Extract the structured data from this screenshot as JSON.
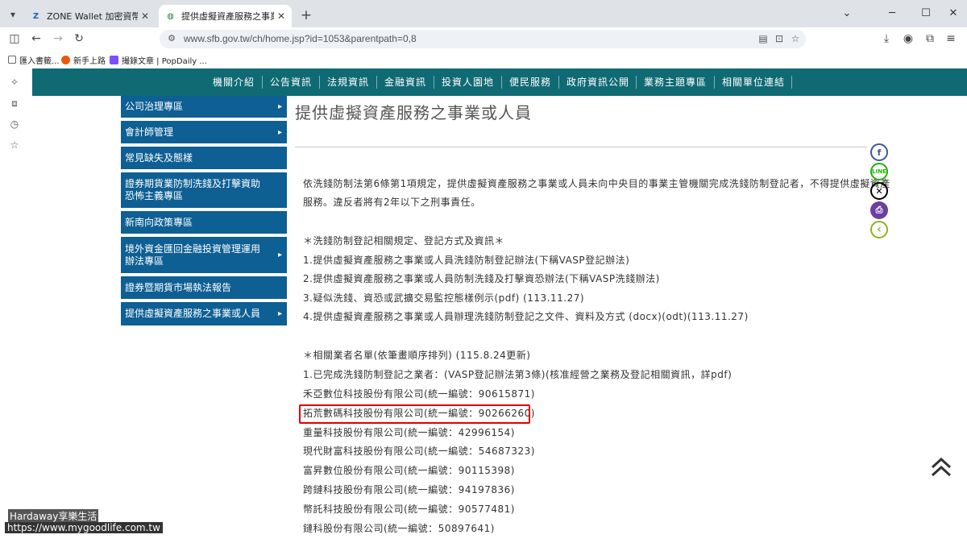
{
  "browser": {
    "tabs": [
      {
        "title": "ZONE Wallet 加密資幣交易所｜",
        "active": false
      },
      {
        "title": "提供虛擬資產服務之事業或人員",
        "active": true
      }
    ],
    "url": "www.sfb.gov.tw/ch/home.jsp?id=1053&parentpath=0,8",
    "bookmarks": [
      "匯入書籤...",
      "新手上路",
      "撮錄文章 | PopDaily ..."
    ]
  },
  "nav": {
    "items": [
      "機關介紹",
      "公告資訊",
      "法規資訊",
      "金融資訊",
      "投資人園地",
      "便民服務",
      "政府資訊公開",
      "業務主題專區",
      "相關單位連結"
    ]
  },
  "sidebar": {
    "items": [
      {
        "label": "公司治理專區",
        "arrow": "▸"
      },
      {
        "label": "會計師管理",
        "arrow": "▸"
      },
      {
        "label": "常見缺失及態樣",
        "arrow": ""
      },
      {
        "label": "證券期貨業防制洗錢及打擊資助恐怖主義專區",
        "arrow": ""
      },
      {
        "label": "新南向政策專區",
        "arrow": ""
      },
      {
        "label": "境外資金匯回金融投資管理運用辦法專區",
        "arrow": "▸"
      },
      {
        "label": "證券暨期貨市場執法報告",
        "arrow": ""
      },
      {
        "label": "提供虛擬資產服務之事業或人員",
        "arrow": "▸"
      }
    ]
  },
  "main": {
    "title": "提供虛擬資產服務之事業或人員",
    "intro_line1": "依洗錢防制法第6條第1項規定，提供虛擬資產服務之事業或人員未向中央目的事業主管機關完成洗錢防制登記者，不得提供虛擬資產",
    "intro_line2": "服務。違反者將有2年以下之刑事責任。",
    "section1_heading": "＊洗錢防制登記相關規定、登記方式及資訊＊",
    "section1_links": [
      "1.提供虛擬資產服務之事業或人員洗錢防制登記辦法(下稱VASP登記辦法)",
      "2.提供虛擬資產服務之事業或人員防制洗錢及打擊資恐辦法(下稱VASP洗錢辦法)",
      "3.疑似洗錢、資恐或武擴交易監控態樣例示(pdf) (113.11.27)",
      "4.提供虛擬資產服務之事業或人員辦理洗錢防制登記之文件、資料及方式 (docx)(odt)(113.11.27)"
    ],
    "section2_heading": "＊相關業者名單(依筆畫順序排列) (115.8.24更新)",
    "section2_subheading": "1.已完成洗錢防制登記之業者：(VASP登記辦法第3條)(核准經營之業務及登記相關資訊，詳pdf)",
    "companies": [
      "禾亞數位科技股份有限公司(統一編號：90615871)",
      "拓荒數碼科技股份有限公司(統一編號：90266260)",
      "重量科技股份有限公司(統一編號：42996154)",
      "現代財富科技股份有限公司(統一編號：54687323)",
      "富昇數位股份有限公司(統一編號：90115398)",
      "跨鏈科技股份有限公司(統一編號：94197836)",
      "幣託科技股份有限公司(統一編號：90577481)",
      "鏈科股份有限公司(統一編號：50897641)"
    ]
  },
  "social": {
    "facebook": "f",
    "line": "LINE",
    "x": "✕",
    "print": "⎙",
    "back": "‹"
  },
  "watermark": {
    "line1": "Hardaway享樂生活",
    "line2": "https://www.mygoodlife.com.tw"
  },
  "colors": {
    "nav_bg": "#0f6a73",
    "sidebar_bg": "#0d5f94",
    "highlight": "#e30000"
  }
}
